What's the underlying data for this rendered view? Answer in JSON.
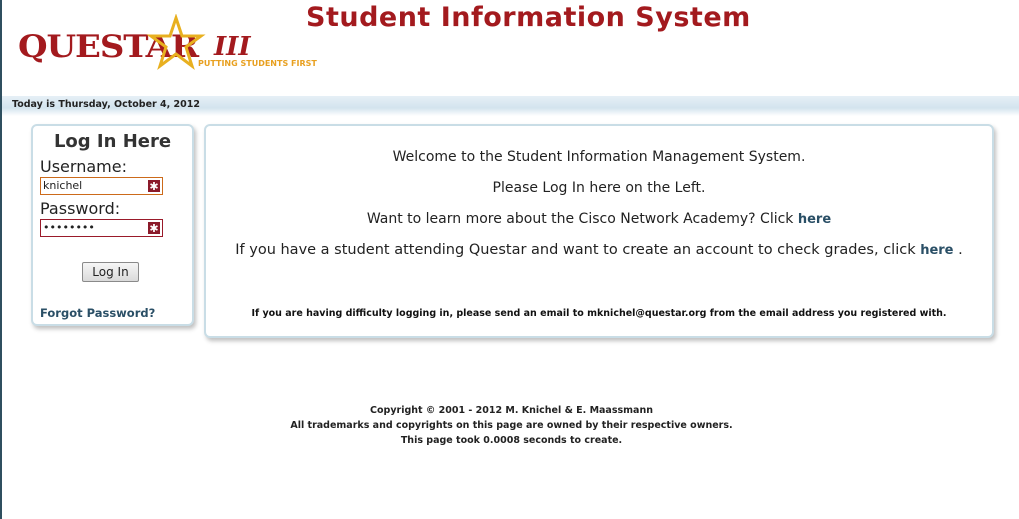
{
  "header": {
    "logo_word": "QUESTAR",
    "logo_suffix": "III",
    "logo_tagline": "PUTTING STUDENTS FIRST",
    "title": "Student Information System"
  },
  "datebar": {
    "text": "Today is Thursday, October 4, 2012"
  },
  "login": {
    "title": "Log In Here",
    "username_label": "Username:",
    "username_value": "knichel",
    "password_label": "Password:",
    "password_value": "••••••••",
    "button_label": "Log In",
    "forgot_label": "Forgot Password?"
  },
  "content": {
    "welcome": "Welcome to the Student Information Management System.",
    "login_prompt": "Please Log In here on the Left.",
    "cisco_text": "Want to learn more about the Cisco Network Academy? Click",
    "cisco_link": "here",
    "account_text": "If you have a student attending Questar and want to create an account to check grades, click",
    "account_link": "here",
    "account_end": ".",
    "difficulty_note": "If you are having difficulty logging in, please send an email to mknichel@questar.org from the email address you registered with."
  },
  "footer": {
    "copyright": "Copyright © 2001 - 2012 M. Knichel & E. Maassmann",
    "trademarks": "All trademarks and copyrights on this page are owned by their respective owners.",
    "timing": "This page took 0.0008 seconds to create."
  },
  "colors": {
    "brand": "#a31a1e",
    "accent_star": "#e8b020",
    "link": "#2a4f66",
    "panel_border": "#c9dde6"
  }
}
